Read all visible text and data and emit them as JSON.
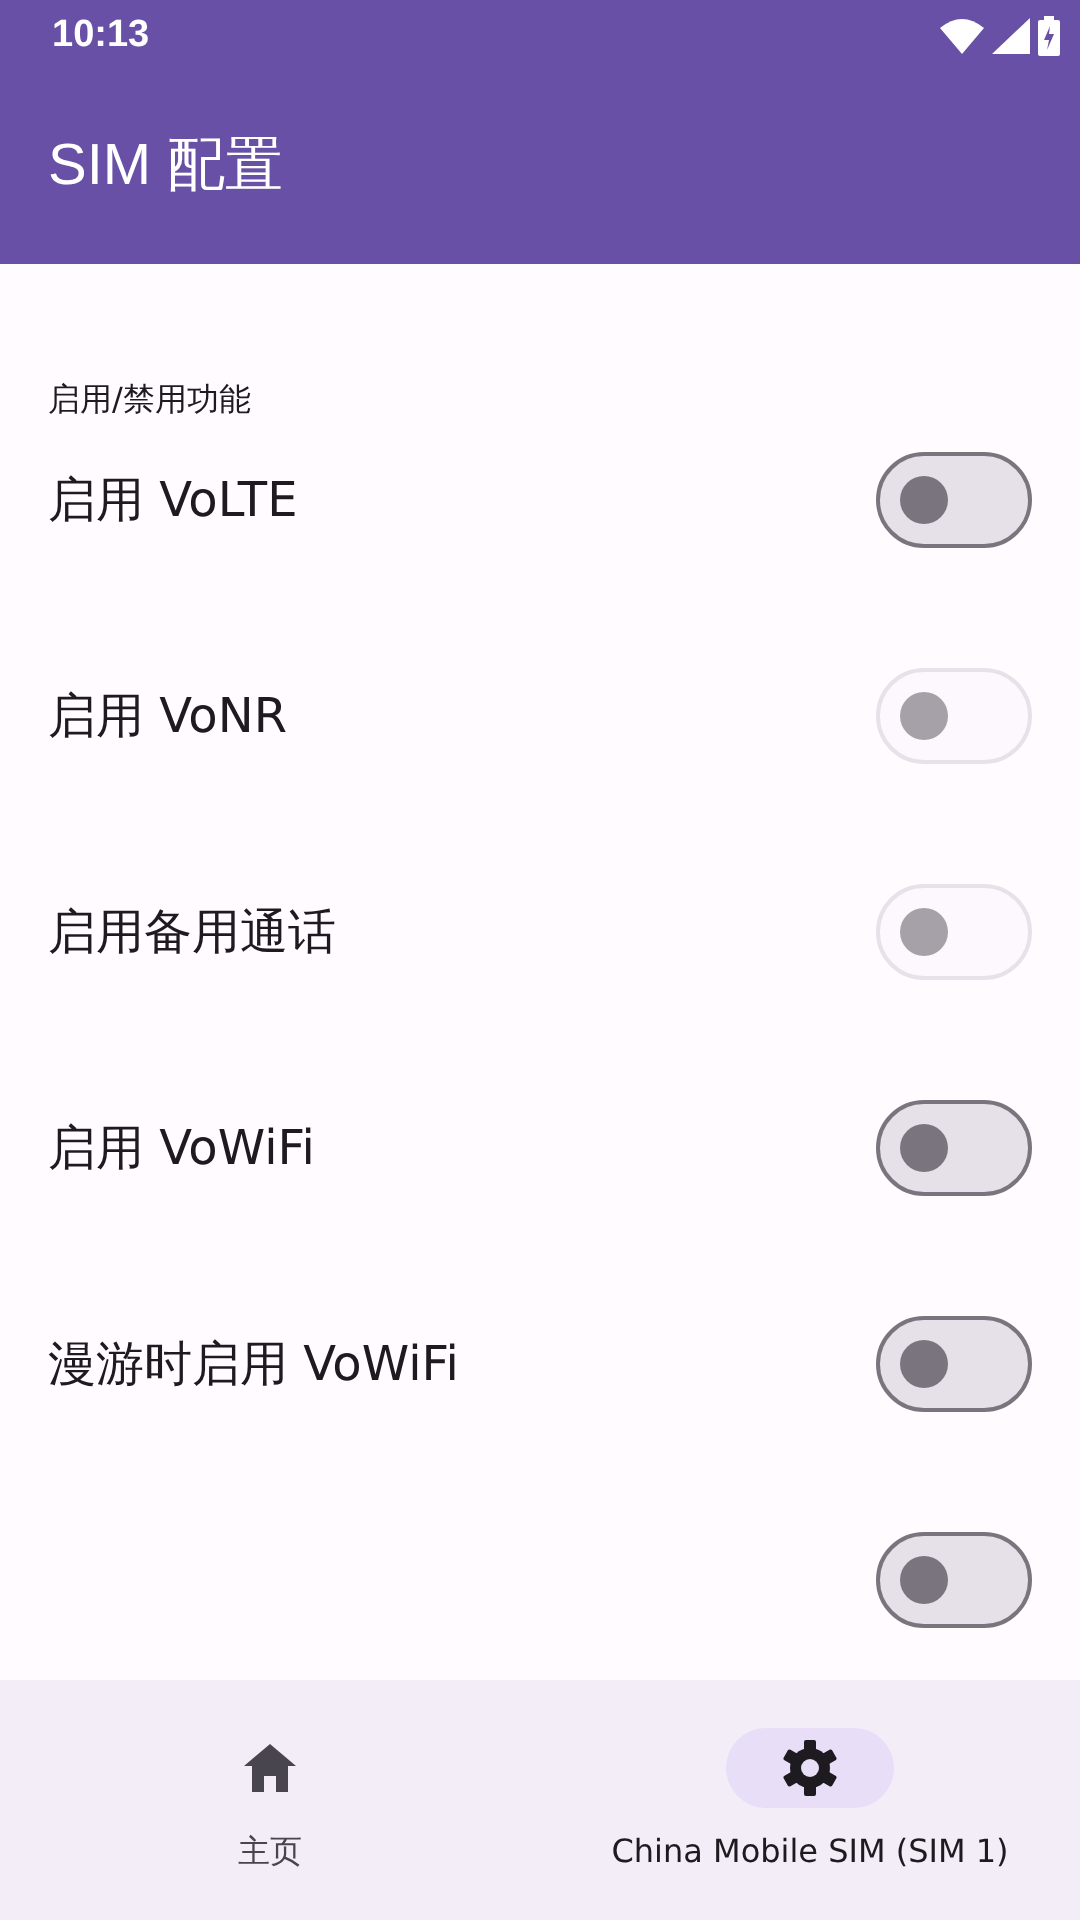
{
  "status_bar": {
    "time": "10:13"
  },
  "app_bar": {
    "title": "SIM 配置"
  },
  "section": {
    "title": "启用/禁用功能"
  },
  "settings": [
    {
      "label": "启用 VoLTE",
      "checked": false,
      "disabled": false
    },
    {
      "label": "启用 VoNR",
      "checked": false,
      "disabled": true
    },
    {
      "label": "启用备用通话",
      "checked": false,
      "disabled": true
    },
    {
      "label": "启用 VoWiFi",
      "checked": false,
      "disabled": false
    },
    {
      "label": "漫游时启用 VoWiFi",
      "checked": false,
      "disabled": false
    },
    {
      "checked": false,
      "disabled": false
    }
  ],
  "bottom_nav": [
    {
      "kind": "home",
      "label": "主页",
      "selected": false
    },
    {
      "kind": "settings",
      "label": "China Mobile SIM (SIM 1)",
      "selected": true
    }
  ]
}
